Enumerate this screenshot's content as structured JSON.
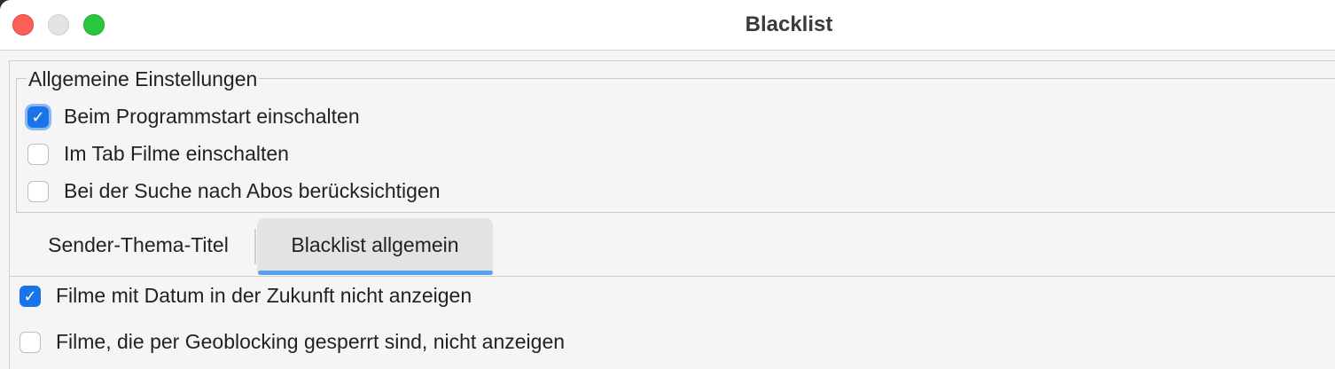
{
  "window": {
    "title": "Blacklist"
  },
  "general_settings": {
    "legend": "Allgemeine Einstellungen",
    "options": [
      {
        "label": "Beim Programmstart einschalten",
        "checked": true
      },
      {
        "label": "Im Tab Filme einschalten",
        "checked": false
      },
      {
        "label": "Bei der Suche nach Abos berücksichtigen",
        "checked": false
      }
    ]
  },
  "tabs": [
    {
      "label": "Sender-Thema-Titel",
      "selected": false
    },
    {
      "label": "Blacklist allgemein",
      "selected": true
    }
  ],
  "blacklist_general": {
    "options": [
      {
        "label": "Filme mit Datum in der Zukunft nicht anzeigen",
        "checked": true
      },
      {
        "label": "Filme, die per Geoblocking gesperrt sind, nicht anzeigen",
        "checked": false
      }
    ]
  },
  "colors": {
    "accent": "#1a73e8",
    "tab_underline": "#5aa0f2",
    "close": "#fe5f57",
    "zoom": "#2ac840"
  }
}
